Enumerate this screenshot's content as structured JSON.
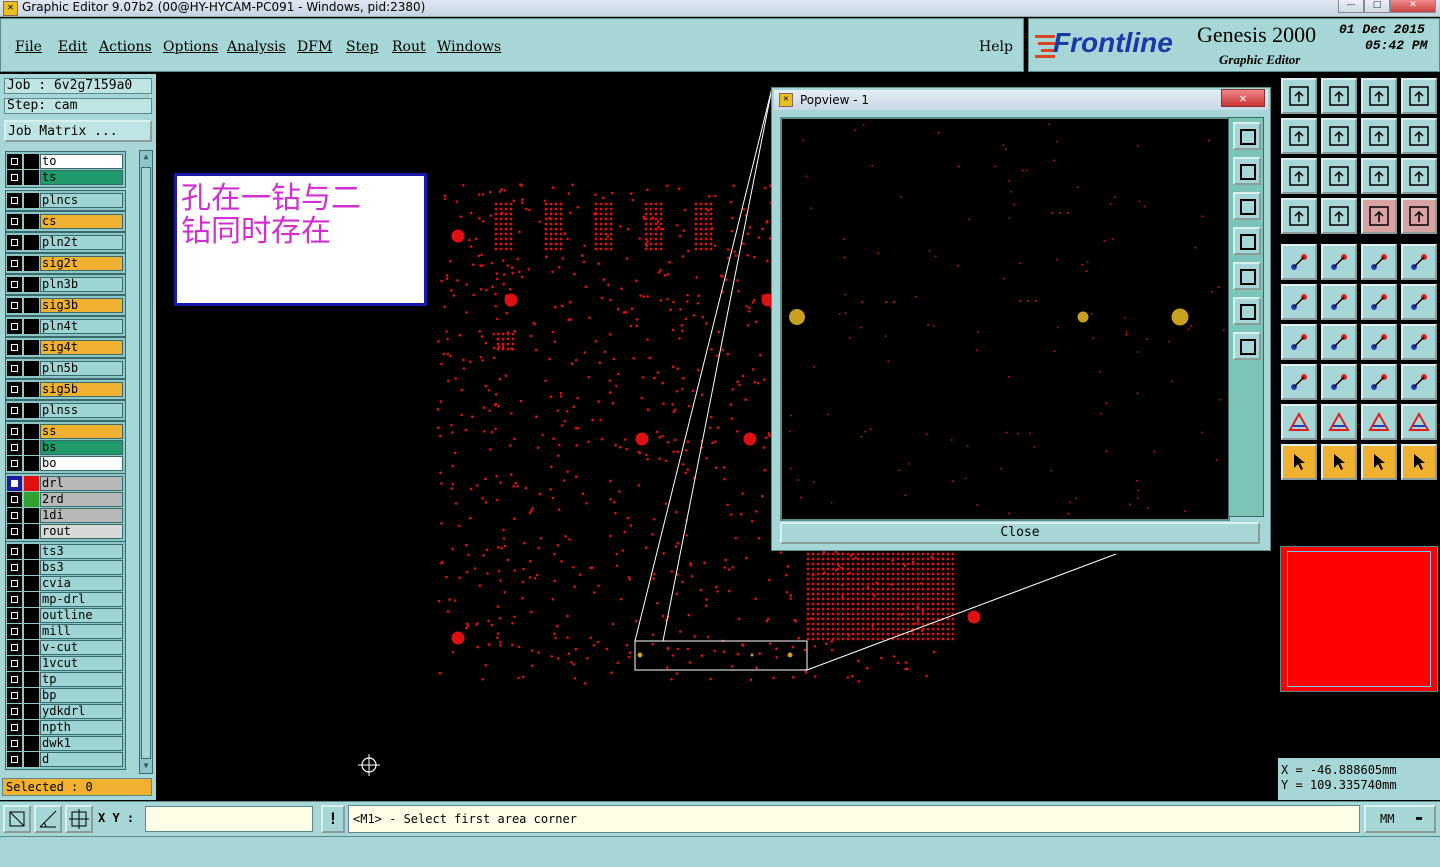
{
  "window": {
    "title": "Graphic Editor 9.07b2 (00@HY-HYCAM-PC091 - Windows, pid:2380)"
  },
  "menu": {
    "items": [
      "File",
      "Edit",
      "Actions",
      "Options",
      "Analysis",
      "DFM",
      "Step",
      "Rout",
      "Windows"
    ],
    "help": "Help"
  },
  "brand": {
    "logo": "Frontline",
    "product": "Genesis 2000",
    "subtitle": "Graphic Editor",
    "date": "01 Dec 2015",
    "time": "05:42 PM"
  },
  "job": {
    "job_label": "Job : 6v2g7159a0",
    "step_label": "Step: cam",
    "matrix_button": "Job Matrix ..."
  },
  "layers": [
    {
      "name": "to",
      "color": "#ffffff"
    },
    {
      "name": "ts",
      "color": "#1f9a6a"
    },
    {
      "name": "plncs",
      "color": "#9fd4d4"
    },
    {
      "name": "cs",
      "color": "#f0b030"
    },
    {
      "name": "pln2t",
      "color": "#9fd4d4"
    },
    {
      "name": "sig2t",
      "color": "#f0b030"
    },
    {
      "name": "pln3b",
      "color": "#9fd4d4"
    },
    {
      "name": "sig3b",
      "color": "#f0b030"
    },
    {
      "name": "pln4t",
      "color": "#9fd4d4"
    },
    {
      "name": "sig4t",
      "color": "#f0b030"
    },
    {
      "name": "pln5b",
      "color": "#9fd4d4"
    },
    {
      "name": "sig5b",
      "color": "#f0b030"
    },
    {
      "name": "plnss",
      "color": "#9fd4d4"
    },
    {
      "name": "ss",
      "color": "#f0b030"
    },
    {
      "name": "bs",
      "color": "#1f9a6a"
    },
    {
      "name": "bo",
      "color": "#ffffff"
    },
    {
      "name": "drl",
      "color": "#b8b8b8"
    },
    {
      "name": "2rd",
      "color": "#b8b8b8"
    },
    {
      "name": "1di",
      "color": "#b8b8b8"
    },
    {
      "name": "rout",
      "color": "#d8d8d8"
    },
    {
      "name": "ts3",
      "color": "#9fd4d4"
    },
    {
      "name": "bs3",
      "color": "#9fd4d4"
    },
    {
      "name": "cvia",
      "color": "#9fd4d4"
    },
    {
      "name": "mp-drl",
      "color": "#9fd4d4"
    },
    {
      "name": "outline",
      "color": "#9fd4d4"
    },
    {
      "name": "mill",
      "color": "#9fd4d4"
    },
    {
      "name": "v-cut",
      "color": "#9fd4d4"
    },
    {
      "name": "1vcut",
      "color": "#9fd4d4"
    },
    {
      "name": "tp",
      "color": "#9fd4d4"
    },
    {
      "name": "bp",
      "color": "#9fd4d4"
    },
    {
      "name": "ydkdrl",
      "color": "#9fd4d4"
    },
    {
      "name": "npth",
      "color": "#9fd4d4"
    },
    {
      "name": "dwk1",
      "color": "#9fd4d4"
    },
    {
      "name": "d",
      "color": "#9fd4d4"
    }
  ],
  "selected": "Selected : 0",
  "note": {
    "line1": "孔在一钻与二",
    "line2": "钻同时存在"
  },
  "popview": {
    "title": "Popview - 1",
    "close_label": "Close"
  },
  "coords": {
    "x": "X = -46.888605mm",
    "y": "Y = 109.335740mm"
  },
  "status": {
    "xy_label": "X Y :",
    "xy_value": "",
    "message": "<M1> - Select first area corner",
    "units": "MM"
  },
  "colors": {
    "panel": "#a7d6d6",
    "feature": "#dd1111",
    "drill2": "#c8a020",
    "accent_orange": "#f0b030"
  }
}
